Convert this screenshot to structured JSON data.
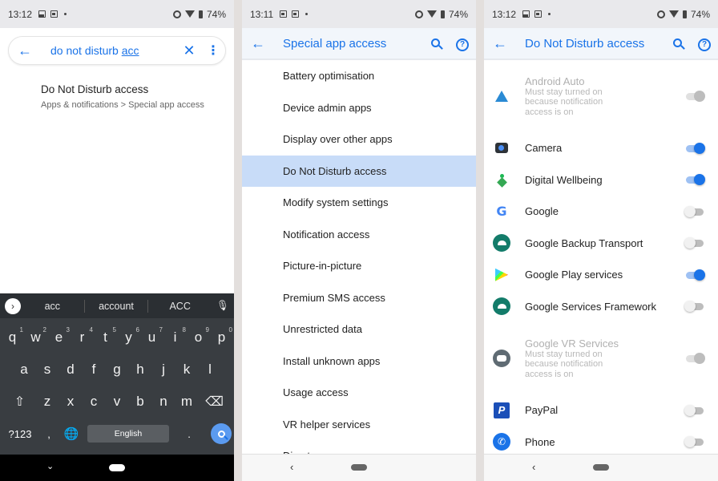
{
  "panel1": {
    "status": {
      "time": "13:12",
      "battery": "74%"
    },
    "search": {
      "query_prefix": "do not disturb ",
      "query_underlined": "acc"
    },
    "result": {
      "title": "Do Not Disturb access",
      "path": "Apps & notifications > Special app access"
    },
    "keyboard": {
      "suggestions": [
        "acc",
        "account",
        "ACC"
      ],
      "row1": [
        [
          "q",
          "1"
        ],
        [
          "w",
          "2"
        ],
        [
          "e",
          "3"
        ],
        [
          "r",
          "4"
        ],
        [
          "t",
          "5"
        ],
        [
          "y",
          "6"
        ],
        [
          "u",
          "7"
        ],
        [
          "i",
          "8"
        ],
        [
          "o",
          "9"
        ],
        [
          "p",
          "0"
        ]
      ],
      "row2": [
        "a",
        "s",
        "d",
        "f",
        "g",
        "h",
        "j",
        "k",
        "l"
      ],
      "row3": [
        "z",
        "x",
        "c",
        "v",
        "b",
        "n",
        "m"
      ],
      "symbols_label": "?123",
      "comma": ",",
      "space_label": "English",
      "period": "."
    }
  },
  "panel2": {
    "status": {
      "time": "13:11",
      "battery": "74%"
    },
    "title": "Special app access",
    "items": [
      "Battery optimisation",
      "Device admin apps",
      "Display over other apps",
      "Do Not Disturb access",
      "Modify system settings",
      "Notification access",
      "Picture-in-picture",
      "Premium SMS access",
      "Unrestricted data",
      "Install unknown apps",
      "Usage access",
      "VR helper services",
      "Directory access"
    ],
    "selected_index": 3
  },
  "panel3": {
    "status": {
      "time": "13:12",
      "battery": "74%"
    },
    "title": "Do Not Disturb access",
    "apps": [
      {
        "name": "Android Auto",
        "icon": "android-auto-icon",
        "state": "disabled-on",
        "sub": "Must stay turned on because notification access is on"
      },
      {
        "name": "Camera",
        "icon": "camera-icon",
        "state": "on"
      },
      {
        "name": "Digital Wellbeing",
        "icon": "digital-wellbeing-icon",
        "state": "on"
      },
      {
        "name": "Google",
        "icon": "google-icon",
        "state": "off"
      },
      {
        "name": "Google Backup Transport",
        "icon": "android-icon",
        "state": "off"
      },
      {
        "name": "Google Play services",
        "icon": "play-services-icon",
        "state": "on"
      },
      {
        "name": "Google Services Framework",
        "icon": "android-icon",
        "state": "off"
      },
      {
        "name": "Google VR Services",
        "icon": "vr-icon",
        "state": "disabled-on",
        "sub": "Must stay turned on because notification access is on"
      },
      {
        "name": "PayPal",
        "icon": "paypal-icon",
        "state": "off"
      },
      {
        "name": "Phone",
        "icon": "phone-icon",
        "state": "off"
      }
    ]
  }
}
